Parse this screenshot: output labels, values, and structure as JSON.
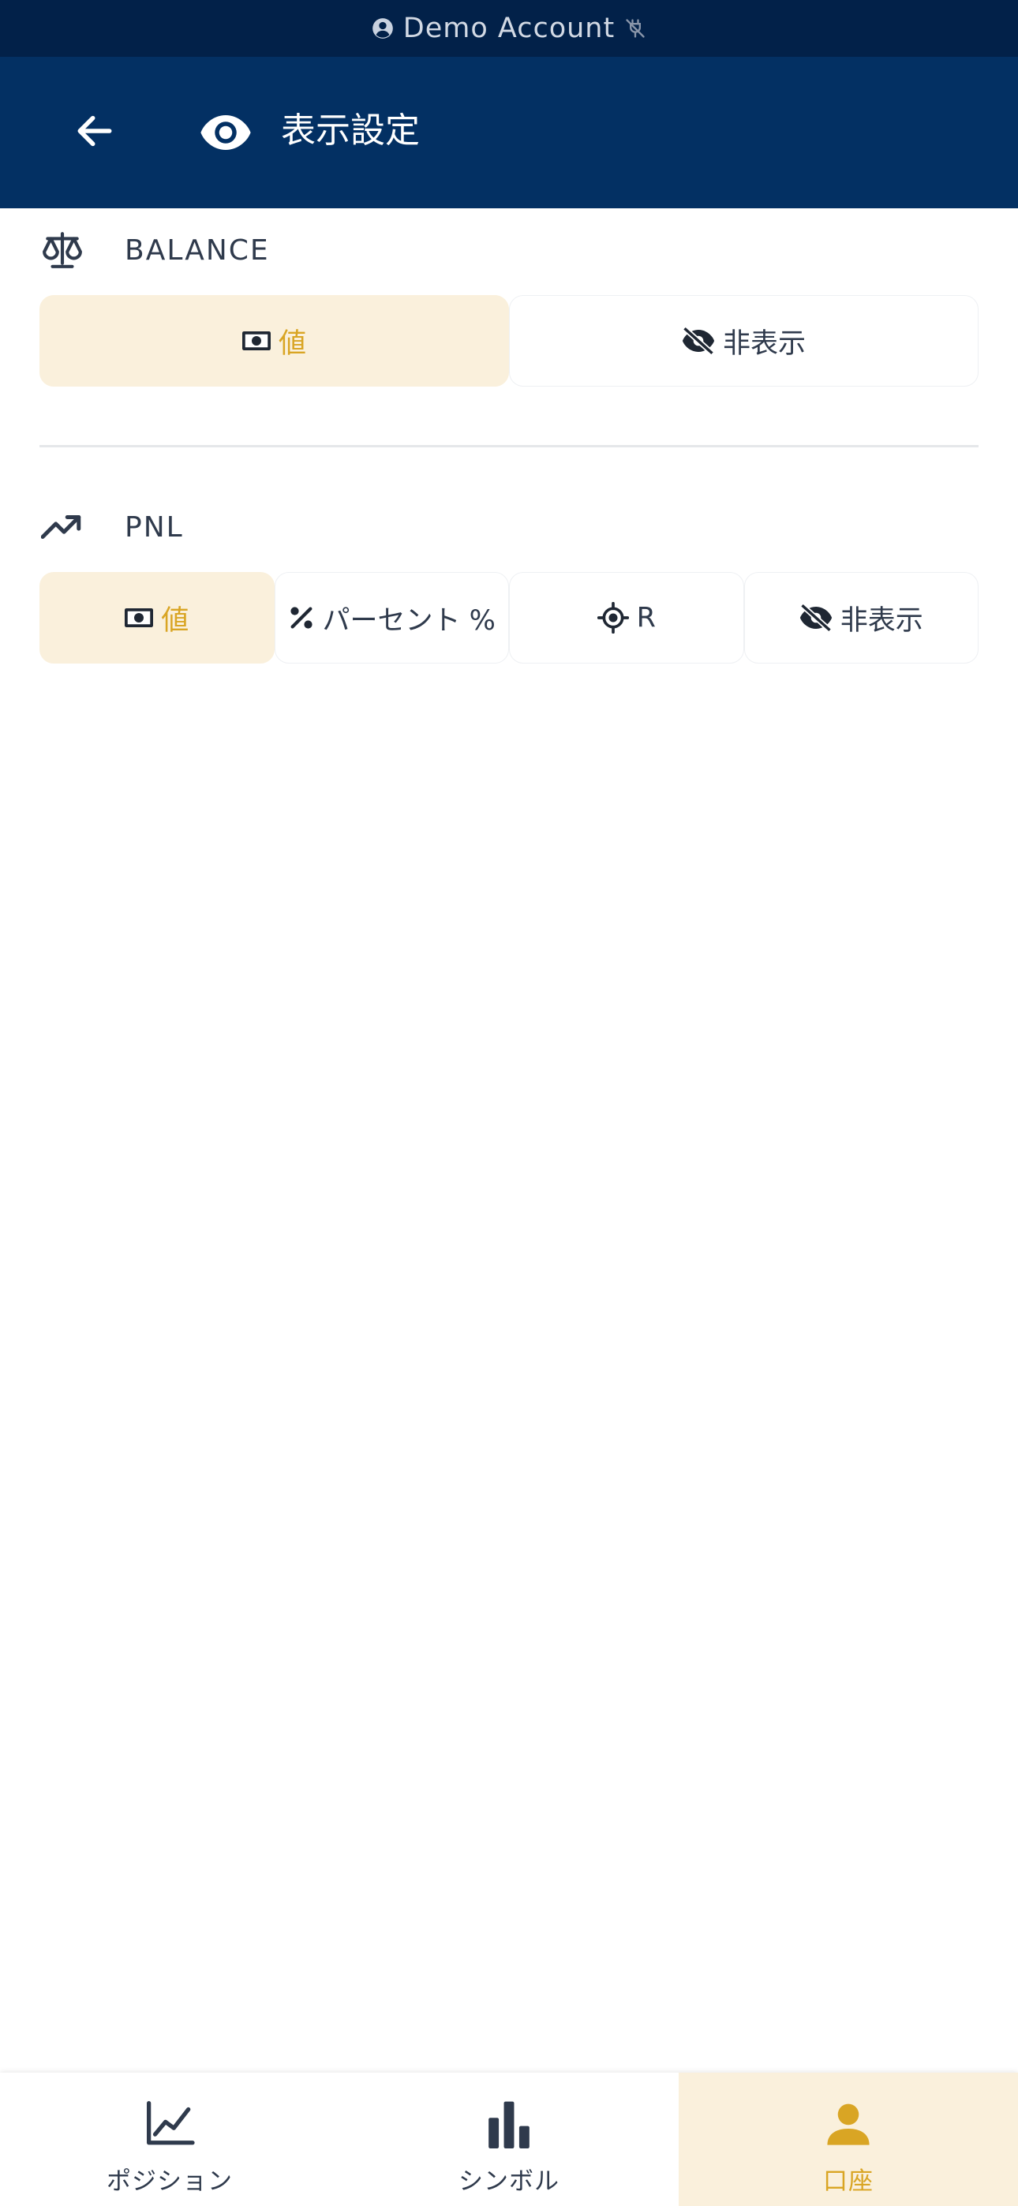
{
  "status_bar": {
    "account_label": "Demo Account",
    "account_icon": "user-circle-icon",
    "connection_icon": "disconnected-plug-icon"
  },
  "header": {
    "title": "表示設定",
    "back_icon": "arrow-left-icon",
    "title_icon": "eye-icon"
  },
  "sections": [
    {
      "label": "BALANCE",
      "icon": "scale-icon",
      "options": [
        {
          "label": "値",
          "icon": "money-icon",
          "selected": true
        },
        {
          "label": "非表示",
          "icon": "eye-off-icon",
          "selected": false
        }
      ]
    },
    {
      "label": "PNL",
      "icon": "trending-up-icon",
      "options": [
        {
          "label": "値",
          "icon": "money-icon",
          "selected": true
        },
        {
          "label": "パーセント %",
          "icon": "percent-icon",
          "selected": false
        },
        {
          "label": "R",
          "icon": "crosshair-icon",
          "selected": false
        },
        {
          "label": "非表示",
          "icon": "eye-off-icon",
          "selected": false
        }
      ]
    }
  ],
  "bottom_nav": {
    "items": [
      {
        "label": "ポジション",
        "icon": "line-chart-icon",
        "active": false
      },
      {
        "label": "シンボル",
        "icon": "bar-chart-icon",
        "active": false
      },
      {
        "label": "口座",
        "icon": "person-icon",
        "active": true
      }
    ]
  },
  "colors": {
    "status_bar_bg": "#022149",
    "header_bg": "#033063",
    "accent": "#d9a524",
    "selected_bg": "#faf0dc",
    "text_dark": "#2f3a4c"
  }
}
